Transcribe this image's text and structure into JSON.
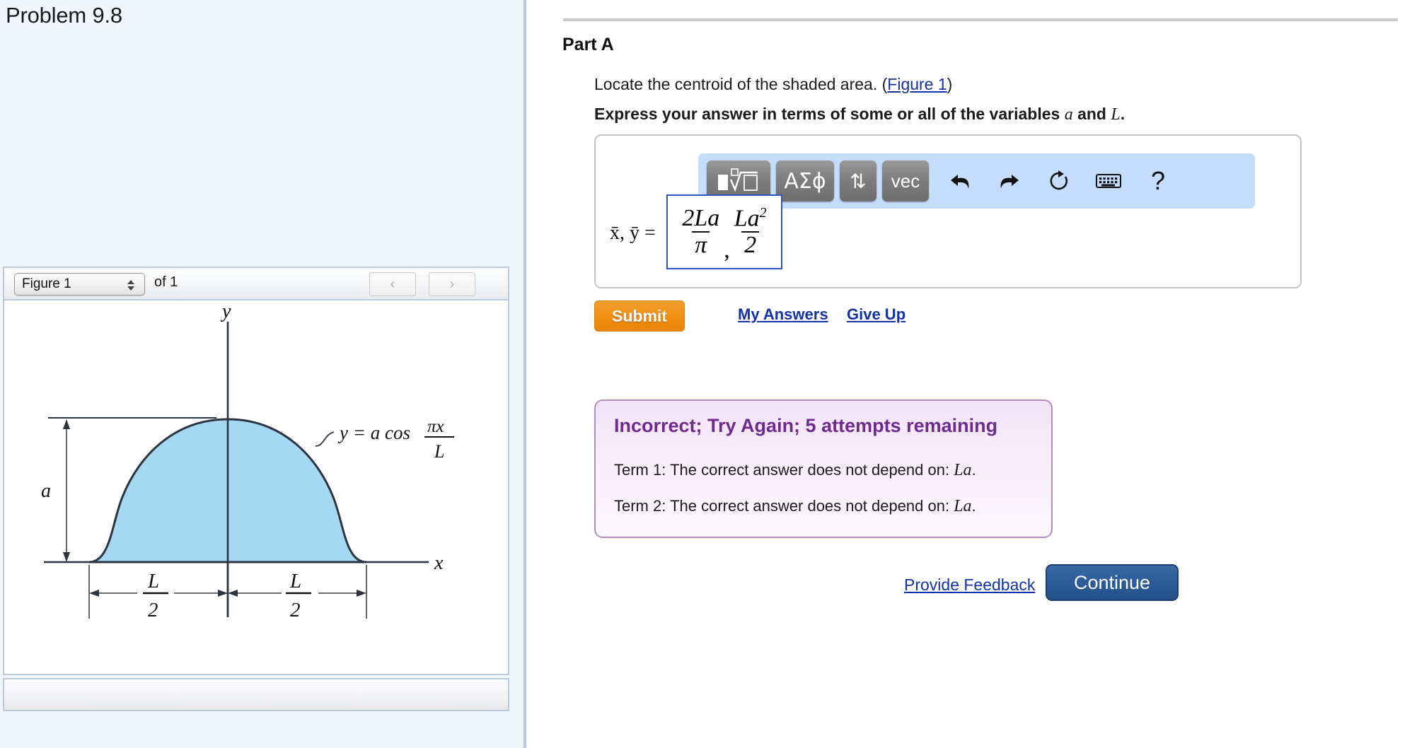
{
  "problem": {
    "title": "Problem 9.8"
  },
  "figure_widget": {
    "select_value": "Figure 1",
    "of_label": "of 1",
    "prev_icon": "chevron-left-icon",
    "next_icon": "chevron-right-icon",
    "prev_label": "‹",
    "next_label": "›"
  },
  "figure": {
    "y_axis_label": "y",
    "x_axis_label": "x",
    "height_label": "a",
    "curve_label_prefix": "y = a cos",
    "curve_label_num": "πx",
    "curve_label_den": "L",
    "dim_left_num": "L",
    "dim_left_den": "2",
    "dim_right_num": "L",
    "dim_right_den": "2",
    "fill_color": "#a5d8f3",
    "stroke_color": "#2b3440"
  },
  "part": {
    "label": "Part A",
    "question_text": "Locate the centroid of the shaded area. (",
    "question_link": "Figure 1",
    "question_text_end": ")",
    "express_prefix": "Express your answer in terms of some or all of the variables ",
    "express_var1": "a",
    "express_mid": " and ",
    "express_var2": "L",
    "express_suffix": "."
  },
  "math_toolbar": {
    "root_button": "root-button",
    "greek_button": "ΑΣϕ",
    "updown_button": "⇅",
    "vec_button": "vec",
    "undo_icon": "undo-icon",
    "redo_icon": "redo-icon",
    "reset_icon": "reset-icon",
    "keyboard_icon": "keyboard-icon",
    "help_label": "?"
  },
  "answer": {
    "prefix": "x̄, ȳ =",
    "term1_num": "2La",
    "term1_den": "π",
    "separator": ",",
    "term2_num": "La",
    "term2_num_exp": "2",
    "term2_den": "2",
    "border_color": "#2d56bf"
  },
  "actions": {
    "submit_label": "Submit",
    "my_answers_label": "My Answers",
    "give_up_label": "Give Up",
    "provide_feedback_label": "Provide Feedback",
    "continue_label": "Continue"
  },
  "feedback": {
    "title": "Incorrect; Try Again; 5 attempts remaining",
    "term1_text": "Term 1: The correct answer does not depend on: ",
    "term1_var": "La",
    "term1_end": ".",
    "term2_text": "Term 2: The correct answer does not depend on: ",
    "term2_var": "La",
    "term2_end": ".",
    "title_color": "#6f2a8e",
    "bg_color": "#f7edfa",
    "border_color": "#b68ac2"
  }
}
